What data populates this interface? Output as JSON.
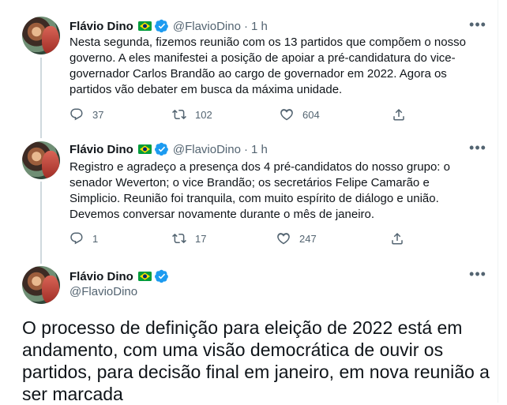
{
  "tweets": [
    {
      "name": "Flávio Dino",
      "handle": "@FlavioDino",
      "separator": "·",
      "time": "1 h",
      "text": "Nesta segunda, fizemos reunião com os 13 partidos que compõem o nosso governo. A eles manifestei a posição de apoiar a pré-candidatura do vice-governador Carlos Brandão ao cargo de governador em 2022. Agora os partidos vão debater em busca da máxima unidade.",
      "replies": "37",
      "retweets": "102",
      "likes": "604"
    },
    {
      "name": "Flávio Dino",
      "handle": "@FlavioDino",
      "separator": "·",
      "time": "1 h",
      "text": "Registro e agradeço a presença dos 4 pré-candidatos do nosso grupo: o senador Weverton; o vice Brandão; os secretários Felipe Camarão e Simplicio. Reunião foi tranquila, com muito espírito de diálogo e união. Devemos conversar novamente durante o mês de janeiro.",
      "replies": "1",
      "retweets": "17",
      "likes": "247"
    }
  ],
  "focused_tweet": {
    "name": "Flávio Dino",
    "handle": "@FlavioDino",
    "text": "O processo de definição para eleição de 2022 está em andamento, com uma visão democrática de ouvir os partidos, para decisão final em janeiro, em nova reunião a ser marcada"
  },
  "icons": {
    "avatar": "avatar",
    "flag": "brazil-flag-icon",
    "verified": "verified-badge-icon",
    "more": "more-options-icon",
    "reply": "reply-icon",
    "retweet": "retweet-icon",
    "like": "like-icon",
    "share": "share-icon"
  },
  "colors": {
    "verified": "#1d9bf0",
    "text": "#0f1419",
    "secondary": "#536471",
    "thread_line": "#cfd9de"
  }
}
